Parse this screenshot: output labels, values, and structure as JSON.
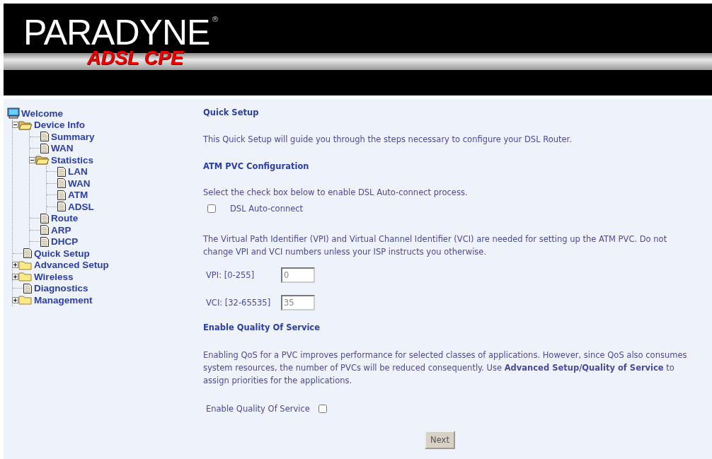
{
  "header": {
    "brand": "PARADYNE",
    "registered": "®",
    "product": "ADSL CPE"
  },
  "tree": [
    {
      "label": "Welcome",
      "kind": "computer",
      "children": [
        {
          "label": "Device Info",
          "kind": "folder",
          "expanded": true,
          "children": [
            {
              "label": "Summary",
              "kind": "page"
            },
            {
              "label": "WAN",
              "kind": "page"
            },
            {
              "label": "Statistics",
              "kind": "folder",
              "expanded": true,
              "children": [
                {
                  "label": "LAN",
                  "kind": "page"
                },
                {
                  "label": "WAN",
                  "kind": "page"
                },
                {
                  "label": "ATM",
                  "kind": "page"
                },
                {
                  "label": "ADSL",
                  "kind": "page"
                }
              ]
            },
            {
              "label": "Route",
              "kind": "page"
            },
            {
              "label": "ARP",
              "kind": "page"
            },
            {
              "label": "DHCP",
              "kind": "page"
            }
          ]
        },
        {
          "label": "Quick Setup",
          "kind": "page"
        },
        {
          "label": "Advanced Setup",
          "kind": "folder",
          "expanded": false
        },
        {
          "label": "Wireless",
          "kind": "folder",
          "expanded": false
        },
        {
          "label": "Diagnostics",
          "kind": "page"
        },
        {
          "label": "Management",
          "kind": "folder",
          "expanded": false
        }
      ]
    }
  ],
  "main": {
    "title": "Quick Setup",
    "intro": "This Quick Setup will guide you through the steps necessary to configure your DSL Router.",
    "atm": {
      "heading": "ATM PVC Configuration",
      "instruction": "Select the check box below to enable DSL Auto-connect process.",
      "auto_connect": {
        "label": "DSL Auto-connect",
        "checked": false
      },
      "description": "The Virtual Path Identifier (VPI) and Virtual Channel Identifier (VCI) are needed for setting up the ATM PVC. Do not change VPI and VCI numbers unless your ISP instructs you otherwise.",
      "fields": [
        {
          "label": "VPI: [0-255]",
          "value": "0"
        },
        {
          "label": "VCI: [32-65535]",
          "value": "35"
        }
      ]
    },
    "qos": {
      "heading": "Enable Quality Of Service",
      "description": "Enabling QoS for a PVC improves performance for selected classes of applications. However, since QoS also consumes system resources, the number of PVCs will be reduced consequently. Use **Advanced Setup/Quality of Service** to assign priorities for the applications.",
      "enable": {
        "label": "Enable Quality Of Service",
        "checked": false
      }
    },
    "next_button": "Next"
  }
}
